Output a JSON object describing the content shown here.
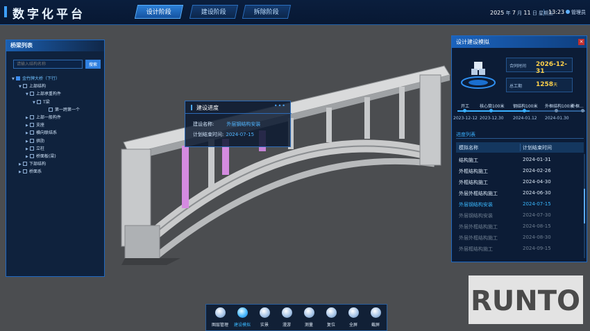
{
  "header": {
    "title": "数字化平台",
    "tabs": [
      {
        "label": "设计阶段",
        "active": true
      },
      {
        "label": "建设阶段",
        "active": false
      },
      {
        "label": "拆除阶段",
        "active": false
      }
    ],
    "date": {
      "year": "2025",
      "year_unit": "年",
      "month": "7",
      "month_unit": "月",
      "day": "11",
      "day_unit": "日",
      "weekday": "星期五"
    },
    "time": "13:23",
    "user": "管理员"
  },
  "left_panel": {
    "title": "桥梁列表",
    "search_placeholder": "请输入结构名称",
    "search_button": "搜索",
    "tree": [
      {
        "label": "金竹牌大桥（下行）",
        "level": 0,
        "expanded": true,
        "checked": true,
        "root": true
      },
      {
        "label": "上部结构",
        "level": 1,
        "expanded": true
      },
      {
        "label": "上部承重构件",
        "level": 2,
        "expanded": true
      },
      {
        "label": "T梁",
        "level": 3,
        "expanded": true
      },
      {
        "label": "第一跨第一个",
        "level": 4
      },
      {
        "label": "上部一般构件",
        "level": 2,
        "expanded": false
      },
      {
        "label": "支座",
        "level": 2,
        "expanded": false
      },
      {
        "label": "横向联结系",
        "level": 2,
        "expanded": false
      },
      {
        "label": "拱肋",
        "level": 2,
        "expanded": false
      },
      {
        "label": "立柱",
        "level": 2,
        "expanded": false
      },
      {
        "label": "桥面板(梁)",
        "level": 2,
        "expanded": false
      },
      {
        "label": "下部结构",
        "level": 1,
        "expanded": false
      },
      {
        "label": "桥面系",
        "level": 1,
        "expanded": false
      }
    ]
  },
  "popup": {
    "title": "建设进度",
    "dots": "•••",
    "name_label": "建设名称:",
    "name_value": "外层钢结构安装",
    "end_label": "计划结束时间:",
    "end_value": "2024-07-15"
  },
  "right_panel": {
    "title": "设计建设模拟",
    "close": "×",
    "contract_label": "合同时间",
    "contract_value": "2026-12-31",
    "duration_label": "总工期",
    "duration_value": "1258",
    "duration_unit": "天",
    "timeline": [
      {
        "label": "开工",
        "date": "2023-12-12",
        "done": true
      },
      {
        "label": "核心筒100米",
        "date": "2023-12.30",
        "done": true
      },
      {
        "label": "钢结构100米",
        "date": "2024-01.12",
        "done": true
      },
      {
        "label": "外框结构100米",
        "date": "2024-01.30",
        "done": false
      },
      {
        "label": "外框...",
        "date": "",
        "done": false
      }
    ],
    "list_title": "进度列表",
    "columns": [
      "模拟名称",
      "计划结束时间"
    ],
    "rows": [
      {
        "name": "结构施工",
        "date": "2024-01-31",
        "state": "done"
      },
      {
        "name": "外框结构施工",
        "date": "2024-02-26",
        "state": "done"
      },
      {
        "name": "外框结构施工",
        "date": "2024-04-30",
        "state": "done"
      },
      {
        "name": "外层外框结构施工",
        "date": "2024-06-30",
        "state": "done"
      },
      {
        "name": "外层钢结构安装",
        "date": "2024-07-15",
        "state": "current"
      },
      {
        "name": "外层钢结构安装",
        "date": "2024-07-30",
        "state": "future"
      },
      {
        "name": "外层外框结构施工",
        "date": "2024-08-15",
        "state": "future"
      },
      {
        "name": "外层外框结构施工",
        "date": "2024-08-30",
        "state": "future"
      },
      {
        "name": "外层框结构施工",
        "date": "2024-09-15",
        "state": "future"
      }
    ]
  },
  "toolbar": [
    {
      "label": "图层管理",
      "icon": "layers-icon",
      "active": false
    },
    {
      "label": "建设模拟",
      "icon": "crane-icon",
      "active": true
    },
    {
      "label": "实景",
      "icon": "globe-icon",
      "active": false
    },
    {
      "label": "漫游",
      "icon": "paper-plane-icon",
      "active": false
    },
    {
      "label": "测量",
      "icon": "ruler-icon",
      "active": false
    },
    {
      "label": "复位",
      "icon": "reset-icon",
      "active": false
    },
    {
      "label": "全屏",
      "icon": "fullscreen-icon",
      "active": false
    },
    {
      "label": "截屏",
      "icon": "screenshot-icon",
      "active": false
    }
  ],
  "watermark": "RUNTO"
}
